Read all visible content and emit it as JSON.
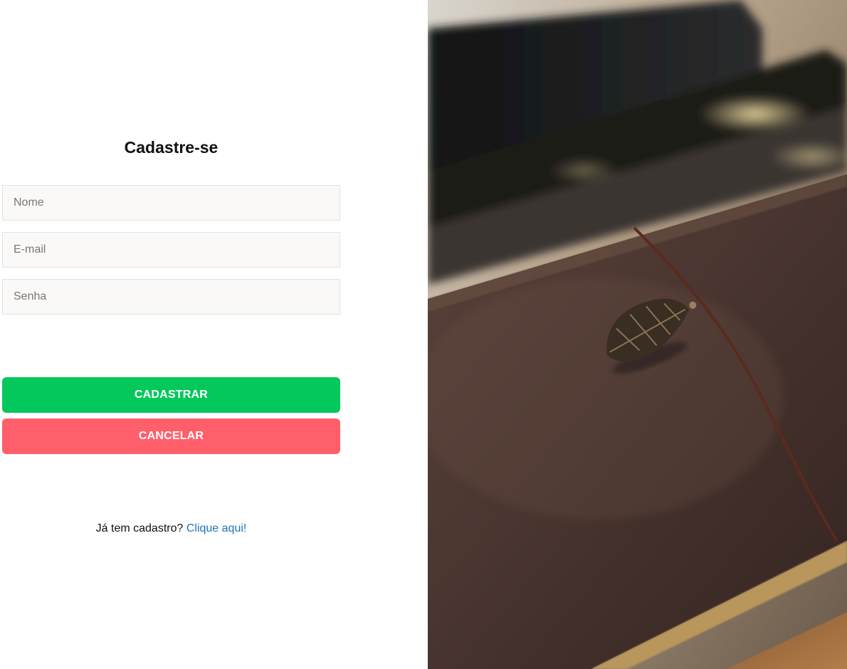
{
  "form": {
    "title": "Cadastre-se",
    "name_placeholder": "Nome",
    "email_placeholder": "E-mail",
    "password_placeholder": "Senha",
    "submit_label": "CADASTRAR",
    "cancel_label": "CANCELAR",
    "login_prompt": "Já tem cadastro?",
    "login_link": "Clique aqui!"
  },
  "colors": {
    "submit": "#05c85d",
    "cancel": "#ff5f6b",
    "link": "#1f73b7",
    "field_background": "#faf9f7"
  },
  "photo": {
    "subject": "leather-notebook-with-leaf-charm"
  }
}
